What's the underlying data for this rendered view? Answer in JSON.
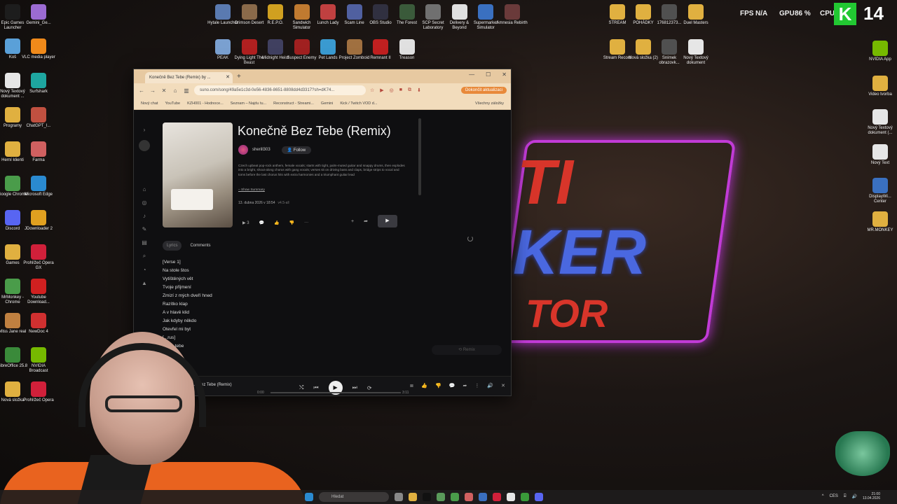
{
  "desktop": {
    "left_icons": [
      {
        "label": "Epic Games Launcher",
        "color": "#1d1d1d"
      },
      {
        "label": "Gemini_Ge...",
        "color": "#9b6bd2"
      },
      {
        "label": "Koš",
        "color": "#5aa0d8"
      },
      {
        "label": "VLC media player",
        "color": "#f08a1a"
      },
      {
        "label": "Nový Textový dokument ...",
        "color": "#e6e6e6"
      },
      {
        "label": "Surfshark",
        "color": "#1ea6a0"
      },
      {
        "label": "Programy",
        "color": "#e0b040"
      },
      {
        "label": "ChatGPT_I...",
        "color": "#c05040"
      },
      {
        "label": "Herní klienti",
        "color": "#e0b040"
      },
      {
        "label": "Farma",
        "color": "#d06060"
      },
      {
        "label": "Google Chrome",
        "color": "#4a9c4a"
      },
      {
        "label": "Microsoft Edge",
        "color": "#2a8ad0"
      },
      {
        "label": "Discord",
        "color": "#5865f2"
      },
      {
        "label": "JDownloader 2",
        "color": "#e0a020"
      },
      {
        "label": "Games",
        "color": "#e0b040"
      },
      {
        "label": "Prohlížeč Opera GX",
        "color": "#d0203a"
      },
      {
        "label": "MrMonkey - Chrome",
        "color": "#4a9c4a"
      },
      {
        "label": "Youtube Download...",
        "color": "#d02020"
      },
      {
        "label": "Miss Jane real",
        "color": "#c08040"
      },
      {
        "label": "NewDoc 4",
        "color": "#d03030"
      },
      {
        "label": "LibreOffice 25.8",
        "color": "#3a8a3a"
      },
      {
        "label": "NVIDIA Broadcast",
        "color": "#76b900"
      },
      {
        "label": "Nová složka",
        "color": "#e0b040"
      },
      {
        "label": "Prohlížeč Opera",
        "color": "#d0203a"
      }
    ],
    "top_icons": [
      {
        "label": "Hytale Launcher",
        "color": "#5a7ab0"
      },
      {
        "label": "Crimson Desert",
        "color": "#8a6a4a"
      },
      {
        "label": "R.E.P.O.",
        "color": "#d0a020"
      },
      {
        "label": "Sandwich Simulator",
        "color": "#c07a30"
      },
      {
        "label": "Lunch Lady",
        "color": "#c04040"
      },
      {
        "label": "Scam Line",
        "color": "#5060a0"
      },
      {
        "label": "OBS Studio",
        "color": "#303040"
      },
      {
        "label": "The Forest",
        "color": "#3a5a3a"
      },
      {
        "label": "SCP Secret Laboratory",
        "color": "#707070"
      },
      {
        "label": "Delivery & Beyond",
        "color": "#e0e0e0"
      },
      {
        "label": "Supermarket Simulator",
        "color": "#3a70c0"
      },
      {
        "label": "Amnesia Rebirth",
        "color": "#6a3a3a"
      },
      {
        "label": "PEAK",
        "color": "#7aa0d0"
      },
      {
        "label": "Dying Light The Beast",
        "color": "#b02020"
      },
      {
        "label": "Midnight Heist",
        "color": "#404060"
      },
      {
        "label": "Suspect Enemy",
        "color": "#a02020"
      },
      {
        "label": "Pet Lands",
        "color": "#3a9ad0"
      },
      {
        "label": "Project Zomboid",
        "color": "#a07040"
      },
      {
        "label": "Remnant II",
        "color": "#c02020"
      },
      {
        "label": "Treason",
        "color": "#e0e0e0"
      }
    ],
    "right_icons": [
      {
        "label": "STREAM",
        "color": "#e0b040"
      },
      {
        "label": "POHÁDKY",
        "color": "#e0b040"
      },
      {
        "label": "176812373...",
        "color": "#505050"
      },
      {
        "label": "Duel Masters",
        "color": "#e0b040"
      },
      {
        "label": "Stream Record",
        "color": "#e0b040"
      },
      {
        "label": "Nová složka (2)",
        "color": "#e0b040"
      },
      {
        "label": "Snímek obrazovk...",
        "color": "#505050"
      },
      {
        "label": "Nový Textový dokument",
        "color": "#e6e6e6"
      },
      {
        "label": "NVIDIA App",
        "color": "#76b900"
      },
      {
        "label": "Video tvorba",
        "color": "#e0b040"
      },
      {
        "label": "Nový Textový dokument (...",
        "color": "#e6e6e6"
      },
      {
        "label": "Nový Text",
        "color": "#e6e6e6"
      },
      {
        "label": "DisplayWi... Center",
        "color": "#3a70c0"
      },
      {
        "label": "MR.MONKEY",
        "color": "#e0b040"
      }
    ],
    "hud": {
      "fps_label": "FPS",
      "fps_value": "N/A",
      "gpu_label": "GPU",
      "gpu_value": "86 %",
      "cpu_label": "CPU",
      "channel_letter": "K",
      "counter": "14"
    },
    "background_art": {
      "line1": "TI",
      "line2": "KER",
      "line3": "TOR"
    }
  },
  "browser": {
    "tab_title": "Konečně Bez Tebe (Remix) by ...",
    "url": "suno.com/song/49a5e1c3d-0e56-4836-8651-8808dd4d3317?sh=dK74...",
    "update_button": "Dokončit aktualizaci",
    "bookmarks": [
      "Nový chat",
      "YouTube",
      "KZH001 - Hodnoce...",
      "Seznam – Najdu tu...",
      "Reconstruct - Streami...",
      "Gemini",
      "Kick / Twitch VOD d..."
    ],
    "bookmarks_all": "Všechny záložky"
  },
  "song": {
    "title": "Konečně Bez Tebe (Remix)",
    "artist": "sherill303",
    "follow_label": "Follow",
    "description": "Czech upbeat pop-rock anthem, female vocals; starts with tight, palm-muted guitar and snappy drums, then explodes into a bright, shout-along chorus with gang vocals; verses sit on driving bass and claps, bridge strips to vocal and toms before the last chorus hits with extra harmonies and a triumphant guitar lead",
    "show_summary": "Show Summary",
    "date": "13. dubna 2026 v 18:54",
    "version": "v4.5-all",
    "play_count": "3",
    "tabs": {
      "lyrics": "Lyrics",
      "comments": "Comments"
    },
    "lyrics": [
      "[Verse 1]",
      "Na stole štos",
      "Vytištěných vět",
      "Tvoje přijmení",
      "Zmizí z mých dveří hned",
      "Razítko klap",
      "A v hlavě klid",
      "Jak kdyby někdo",
      "Otevřel mi byt",
      "[...rus]",
      "...bez tebe",
      "...lehce"
    ],
    "remix_label": "Remix"
  },
  "player": {
    "track": "...ě Bez Tebe (Remix)",
    "current_time": "0:00",
    "duration": "3:11"
  },
  "taskbar": {
    "search_placeholder": "Hledat",
    "lang": "CES",
    "time": "21:00",
    "date": "13.04.2026"
  }
}
